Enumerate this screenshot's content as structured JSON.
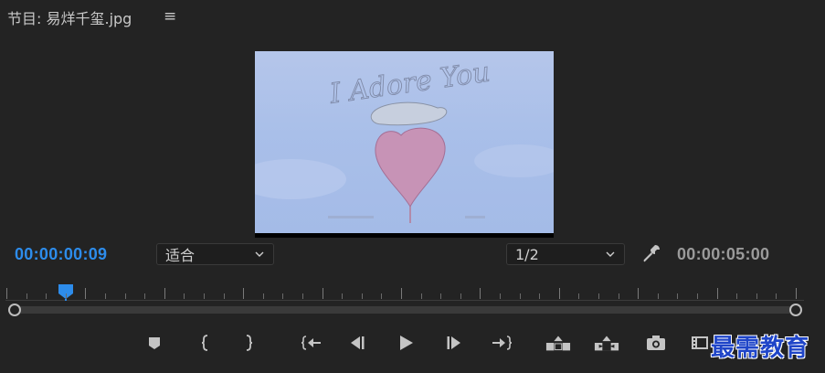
{
  "header": {
    "title": "节目: 易烊千玺.jpg",
    "menu_glyph": "≡"
  },
  "viewer": {
    "image_text": "I Adore You"
  },
  "controls": {
    "current_timecode": "00:00:00:09",
    "zoom_value": "适合",
    "resolution_value": "1/2",
    "duration_timecode": "00:00:05:00"
  },
  "playback_position": {
    "current_seconds": 0.375,
    "duration_seconds": 5.0
  },
  "toolbar": {
    "buttons": [
      "add-marker",
      "mark-in",
      "mark-out",
      "go-to-in",
      "step-back",
      "play",
      "step-forward",
      "go-to-out",
      "lift",
      "extract",
      "export-frame",
      "compare-view"
    ]
  },
  "watermark": {
    "text": "最需教育"
  },
  "colors": {
    "accent": "#2d8ceb",
    "panel_bg": "#232323",
    "text": "#c8c8c8",
    "watermark": "#1f45c8"
  }
}
